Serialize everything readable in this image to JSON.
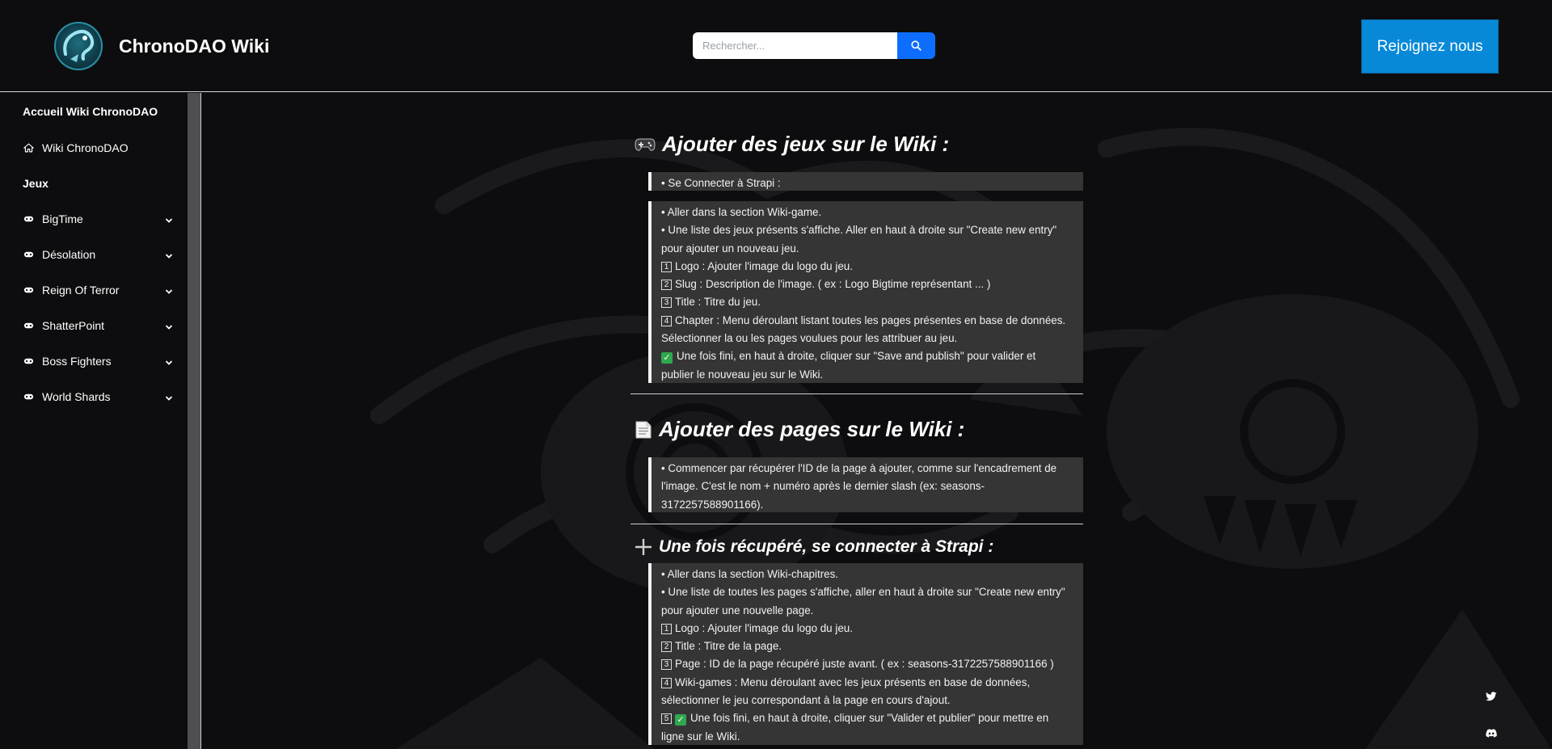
{
  "header": {
    "site_title": "ChronoDAO Wiki",
    "search_placeholder": "Rechercher...",
    "join_label": "Rejoignez nous"
  },
  "sidebar": {
    "home_heading": "Accueil Wiki ChronoDAO",
    "home_link": "Wiki ChronoDAO",
    "games_heading": "Jeux",
    "games": [
      {
        "label": "BigTime"
      },
      {
        "label": "Désolation"
      },
      {
        "label": "Reign Of Terror"
      },
      {
        "label": "ShatterPoint"
      },
      {
        "label": "Boss Fighters"
      },
      {
        "label": "World Shards"
      }
    ]
  },
  "sections": [
    {
      "icon": "gamepad-icon",
      "title": "Ajouter des jeux sur le Wiki :",
      "box1": "• Se Connecter à Strapi :",
      "lines": [
        "• Aller dans la section Wiki-game.",
        "• Une liste des jeux présents s'affiche. Aller en haut à droite sur \"Create new entry\"",
        "pour ajouter un nouveau jeu.",
        "Logo : Ajouter l'image du logo du jeu.",
        "Slug : Description de l'image. ( ex : Logo Bigtime représentant ... )",
        "Title : Titre du jeu.",
        "Chapter : Menu déroulant listant toutes les pages présentes en base de données.",
        "Sélectionner la ou les pages voulues pour les attribuer au jeu.",
        "Une fois fini, en haut à droite, cliquer sur \"Save and publish\" pour valider et",
        "publier le nouveau jeu sur le Wiki."
      ]
    },
    {
      "icon": "page-icon",
      "title": "Ajouter des pages sur le Wiki :",
      "lines": [
        "• Commencer par récupérer l'ID de la page à ajouter, comme sur l'encadrement de",
        "l'image. C'est le nom + numéro après le dernier slash (ex: seasons-",
        "3172257588901166)."
      ]
    },
    {
      "icon": "plus-icon",
      "title": "Une fois récupéré, se connecter à Strapi :",
      "lines": [
        "• Aller dans la section Wiki-chapitres.",
        "• Une liste de toutes les pages s'affiche, aller en haut à droite sur \"Create new entry\"",
        "pour ajouter une nouvelle page.",
        "Logo : Ajouter l'image du logo du jeu.",
        "Title : Titre de la page.",
        "Page : ID de la page récupéré juste avant. ( ex : seasons-3172257588901166 )",
        "Wiki-games : Menu déroulant avec les jeux présents en base de données,",
        "sélectionner le jeu correspondant à la page en cours d'ajout.",
        "Une fois fini, en haut à droite, cliquer sur \"Valider et publier\" pour mettre en",
        "ligne sur le Wiki."
      ]
    }
  ],
  "badges": {
    "n1": "1",
    "n2": "2",
    "n3": "3",
    "n4": "4",
    "n5": "5"
  },
  "colors": {
    "accent": "#0789d8",
    "search_button": "#0d6efd",
    "box": "#353535",
    "check": "#2fa84f"
  },
  "social": [
    "twitter-icon",
    "discord-icon"
  ]
}
